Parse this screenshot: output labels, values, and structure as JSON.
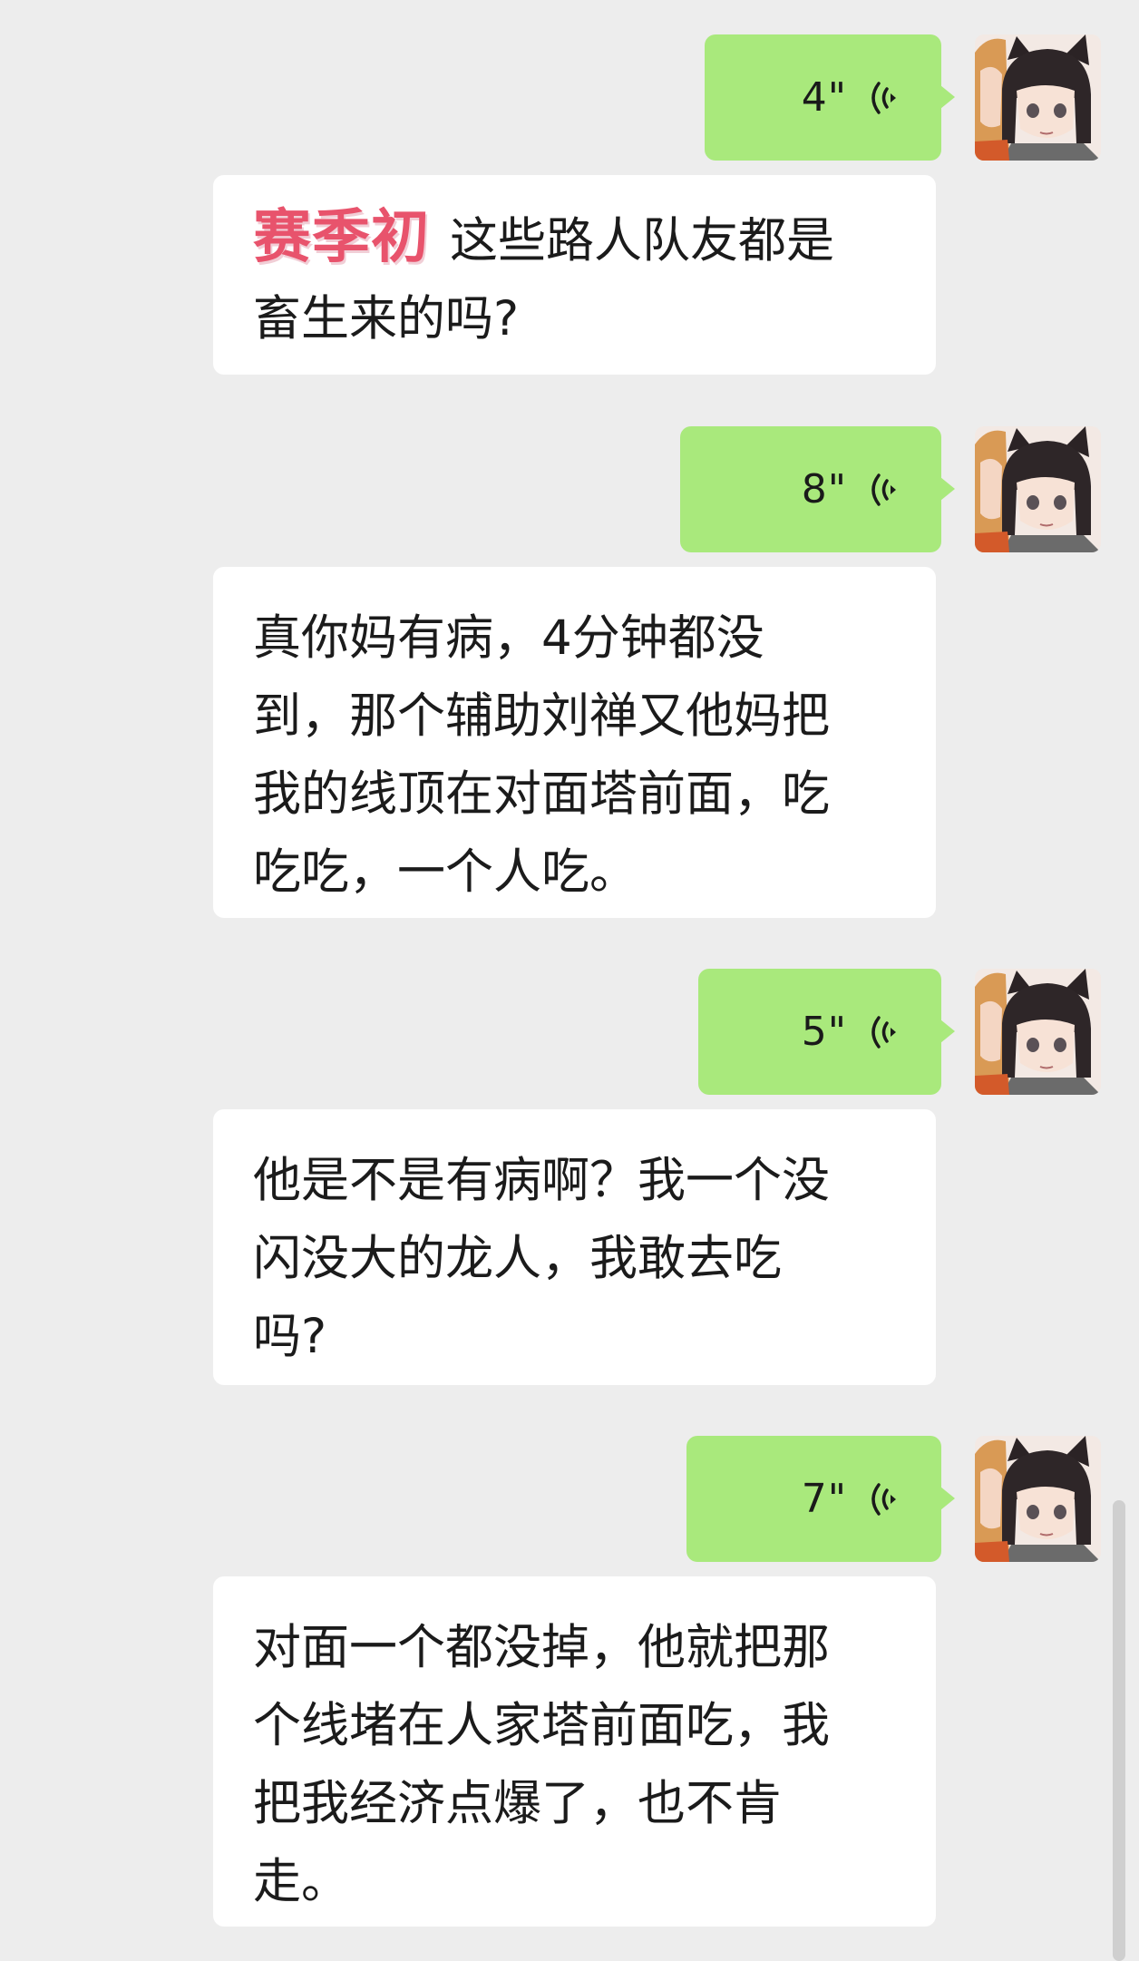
{
  "conversation": {
    "messages": [
      {
        "voice": {
          "duration": "4\""
        },
        "reply": {
          "watermark": "赛季初",
          "text": "这些路人队友都是\n畜生来的吗?"
        }
      },
      {
        "voice": {
          "duration": "8\""
        },
        "reply": {
          "text": "真你妈有病，4分钟都没\n到，那个辅助刘禅又他妈把\n我的线顶在对面塔前面，吃\n吃吃，一个人吃。"
        }
      },
      {
        "voice": {
          "duration": "5\""
        },
        "reply": {
          "text": "他是不是有病啊？我一个没\n闪没大的龙人，我敢去吃\n吗?"
        }
      },
      {
        "voice": {
          "duration": "7\""
        },
        "reply": {
          "text": "对面一个都没掉，他就把那\n个线堵在人家塔前面吃，我\n把我经济点爆了，也不肯\n走。"
        }
      }
    ]
  },
  "icons": {
    "voice": "voice-wave-icon",
    "avatar": "anime-girl-avatar"
  },
  "colors": {
    "background": "#ededed",
    "sent_bubble": "#a9e97c",
    "received_bubble": "#ffffff",
    "watermark": "#e8536c"
  }
}
